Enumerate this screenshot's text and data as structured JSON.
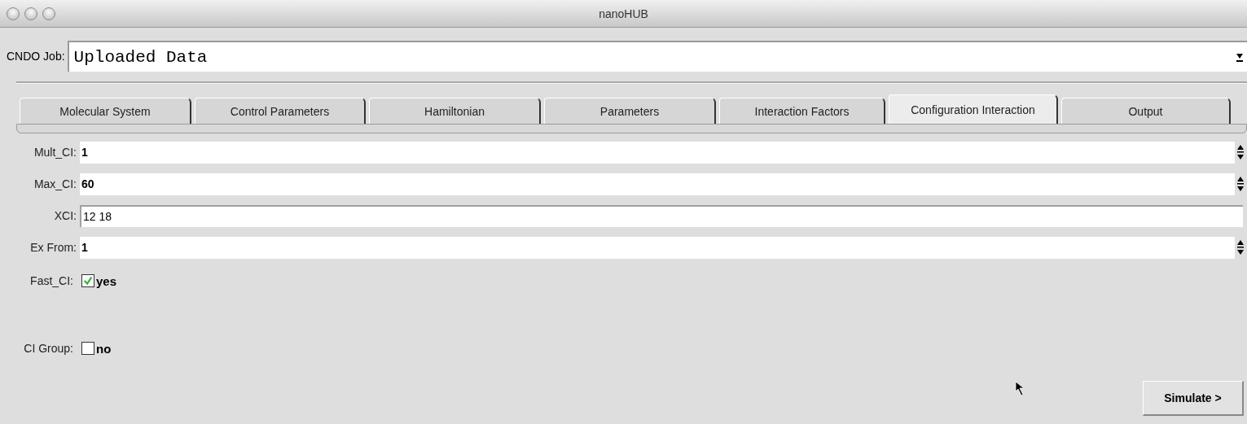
{
  "window": {
    "title": "nanoHUB"
  },
  "job": {
    "label": "CNDO Job:",
    "value": "Uploaded Data"
  },
  "tabs": [
    {
      "label": "Molecular System",
      "selected": false
    },
    {
      "label": "Control Parameters",
      "selected": false
    },
    {
      "label": "Hamiltonian",
      "selected": false
    },
    {
      "label": "Parameters",
      "selected": false
    },
    {
      "label": "Interaction Factors",
      "selected": false
    },
    {
      "label": "Configuration Interaction",
      "selected": true
    },
    {
      "label": "Output",
      "selected": false
    }
  ],
  "fields": [
    {
      "kind": "spinner",
      "label": "Mult_CI:",
      "value": "1"
    },
    {
      "kind": "spinner",
      "label": "Max_CI:",
      "value": "60"
    },
    {
      "kind": "entry",
      "label": "XCI:",
      "value": "12 18"
    },
    {
      "kind": "spinner",
      "label": "Ex From:",
      "value": "1"
    },
    {
      "kind": "checkbox",
      "label": "Fast_CI:",
      "text": "yes",
      "checked": true
    },
    {
      "kind": "checkbox",
      "label": "CI Group:",
      "text": "no",
      "checked": false
    }
  ],
  "simulate_button": "Simulate >"
}
